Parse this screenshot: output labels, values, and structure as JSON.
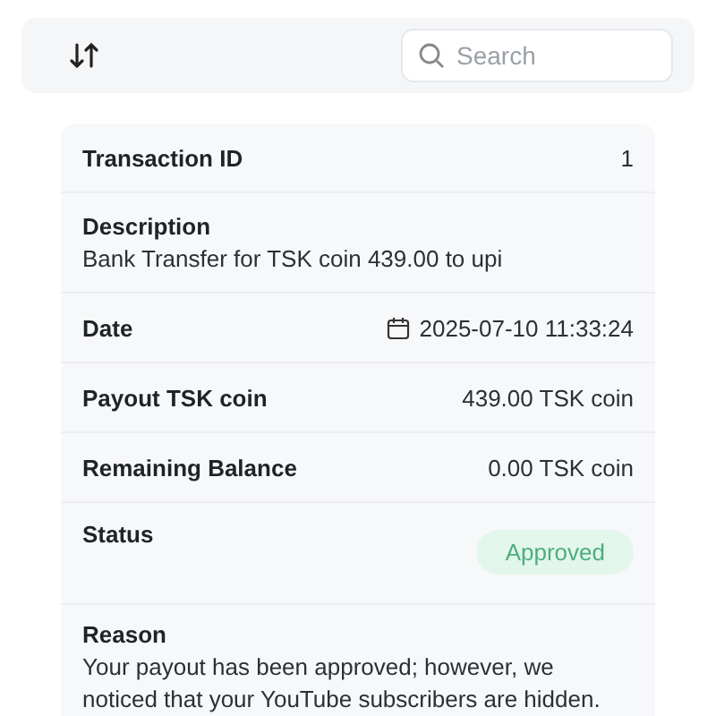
{
  "toolbar": {
    "search": {
      "placeholder": "Search"
    }
  },
  "details": [
    {
      "kind": "inline",
      "label": "Transaction ID",
      "value": "1"
    },
    {
      "kind": "stacked",
      "label": "Description",
      "value": "Bank Transfer for TSK coin 439.00 to upi"
    },
    {
      "kind": "date",
      "label": "Date",
      "value": "2025-07-10 11:33:24"
    },
    {
      "kind": "inline",
      "label": "Payout TSK coin",
      "value": "439.00 TSK coin"
    },
    {
      "kind": "inline",
      "label": "Remaining Balance",
      "value": "0.00 TSK coin"
    },
    {
      "kind": "status",
      "label": "Status",
      "value": "Approved",
      "color": "#e3f6ec"
    },
    {
      "kind": "stacked",
      "label": "Reason",
      "value": "Your payout has been approved; however, we noticed that your YouTube subscribers are hidden."
    }
  ]
}
